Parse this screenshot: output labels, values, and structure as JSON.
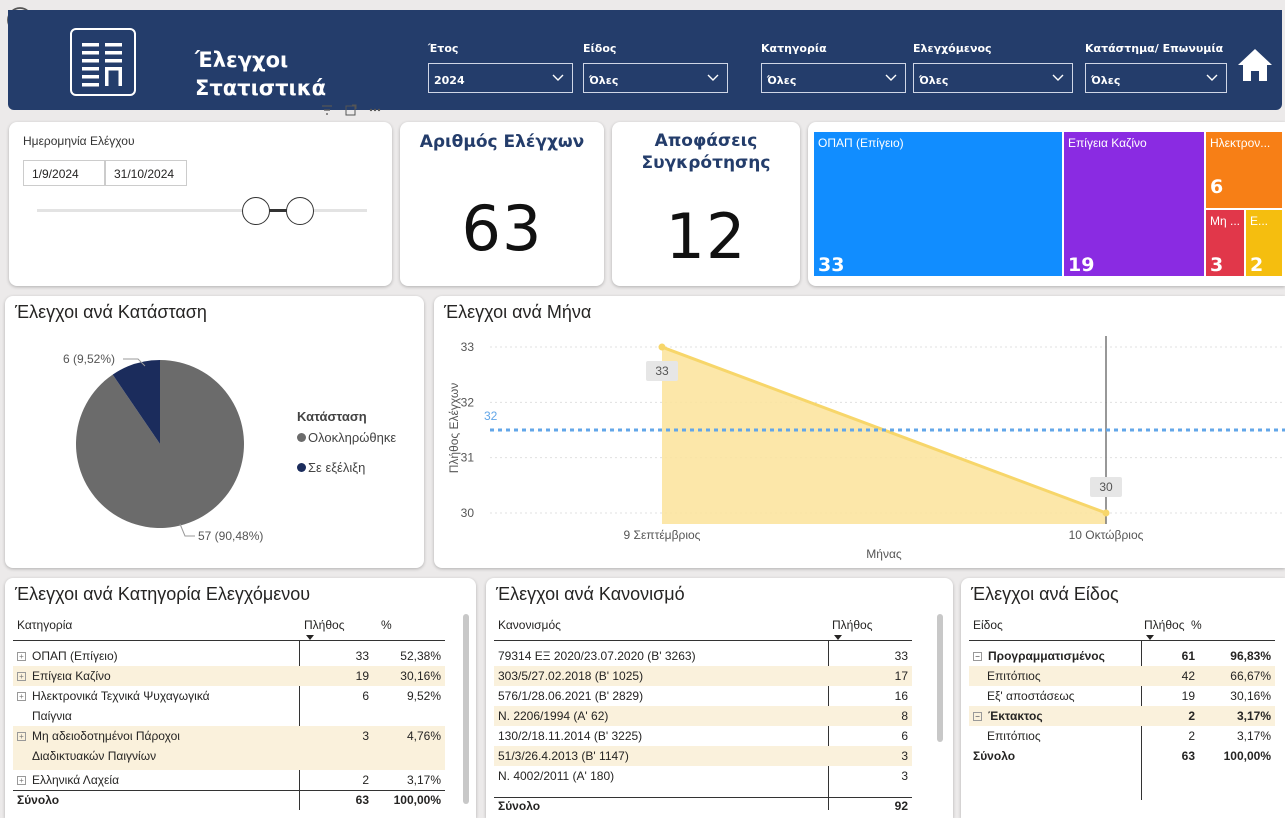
{
  "header": {
    "title_line1": "Έλεγχοι",
    "title_line2": "Στατιστικά",
    "logo_text_top": "ΞΞ",
    "logo_text_bottom": "ΞΠ",
    "filters": [
      {
        "label": "Έτος",
        "value": "2024"
      },
      {
        "label": "Είδος",
        "value": "Όλες"
      },
      {
        "label": "Κατηγορία",
        "value": "Όλες"
      },
      {
        "label": "Ελεγχόμενος",
        "value": "Όλες"
      },
      {
        "label": "Κατάστημα/ Επωνυμία",
        "value": "Όλες"
      }
    ]
  },
  "date_slicer": {
    "label": "Ημερομηνία Ελέγχου",
    "start": "1/9/2024",
    "end": "31/10/2024"
  },
  "kpis": {
    "checks_title": "Αριθμός Ελέγχων",
    "checks_value": "63",
    "decisions_title_line1": "Αποφάσεις",
    "decisions_title_line2": "Συγκρότησης",
    "decisions_value": "12"
  },
  "treemap": [
    {
      "label": "ΟΠΑΠ (Επίγειο)",
      "value": "33",
      "color": "#118dff"
    },
    {
      "label": "Επίγεια Καζίνο",
      "value": "19",
      "color": "#8a2be2"
    },
    {
      "label": "Ηλεκτρον...",
      "value": "6",
      "color": "#f77f16"
    },
    {
      "label": "Μη ...",
      "value": "3",
      "color": "#e1374a"
    },
    {
      "label": "Ε...",
      "value": "2",
      "color": "#f5be0f"
    }
  ],
  "pie_chart": {
    "title": "Έλεγχοι ανά Κατάσταση",
    "legend_title": "Κατάσταση",
    "label_small": "6 (9,52%)",
    "label_big": "57 (90,48%)",
    "colors": {
      "completed": "#6b6b6b",
      "in_progress": "#1b2c5c"
    },
    "chart_data": {
      "type": "pie",
      "categories": [
        "Ολοκληρώθηκε",
        "Σε εξέλιξη"
      ],
      "values": [
        57,
        6
      ]
    }
  },
  "line_chart": {
    "title": "Έλεγχοι ανά Μήνα",
    "ylabel": "Πλήθος Ελέγχων",
    "xlabel": "Μήνας",
    "avg_label": "32",
    "y_ticks": [
      "33",
      "32",
      "31",
      "30"
    ],
    "point_labels": [
      "33",
      "30"
    ],
    "colors": {
      "area": "#fbe39a",
      "line": "#f7d66a",
      "avg": "#62a6e8"
    },
    "chart_data": {
      "type": "area",
      "x": [
        "9 Σεπτέμβριος",
        "10 Οκτώβριος"
      ],
      "series": [
        {
          "values": [
            33,
            30
          ]
        }
      ],
      "average_line": 31.5,
      "ylim": [
        29.8,
        33.2
      ]
    }
  },
  "table_category": {
    "title": "Έλεγχοι ανά Κατηγορία Ελεγχόμενου",
    "headers": [
      "Κατηγορία",
      "Πλήθος",
      "%"
    ],
    "rows": [
      {
        "name": "ΟΠΑΠ (Επίγειο)",
        "count": "33",
        "pct": "52,38%"
      },
      {
        "name": "Επίγεια Καζίνο",
        "count": "19",
        "pct": "30,16%"
      },
      {
        "name": "Ηλεκτρονικά Τεχνικά Ψυχαγωγικά",
        "name2": "Παίγνια",
        "count": "6",
        "pct": "9,52%"
      },
      {
        "name": "Μη αδειοδοτημένοι Πάροχοι",
        "name2": "Διαδικτυακών Παιγνίων",
        "count": "3",
        "pct": "4,76%"
      },
      {
        "name": "Ελληνικά Λαχεία",
        "count": "2",
        "pct": "3,17%"
      }
    ],
    "total": {
      "name": "Σύνολο",
      "count": "63",
      "pct": "100,00%"
    }
  },
  "table_regulation": {
    "title": "Έλεγχοι ανά Κανονισμό",
    "headers": [
      "Κανονισμός",
      "Πλήθος"
    ],
    "rows": [
      {
        "name": "79314 ΕΞ 2020/23.07.2020 (Β' 3263)",
        "count": "33"
      },
      {
        "name": "303/5/27.02.2018 (Β' 1025)",
        "count": "17"
      },
      {
        "name": "576/1/28.06.2021 (Β' 2829)",
        "count": "16"
      },
      {
        "name": "Ν. 2206/1994 (Α' 62)",
        "count": "8"
      },
      {
        "name": "130/2/18.11.2014 (Β' 3225)",
        "count": "6"
      },
      {
        "name": "51/3/26.4.2013 (Β' 1147)",
        "count": "3"
      },
      {
        "name": "Ν. 4002/2011 (Α' 180)",
        "count": "3"
      }
    ],
    "total": {
      "name": "Σύνολο",
      "count": "92"
    }
  },
  "table_type": {
    "title": "Έλεγχοι ανά Είδος",
    "headers": [
      "Είδος",
      "Πλήθος",
      "%"
    ],
    "rows": [
      {
        "name": "Προγραμματισμένος",
        "count": "61",
        "pct": "96,83%"
      },
      {
        "name": "Επιτόπιος",
        "count": "42",
        "pct": "66,67%"
      },
      {
        "name": "Εξ' αποστάσεως",
        "count": "19",
        "pct": "30,16%"
      },
      {
        "name": "Έκτακτος",
        "count": "2",
        "pct": "3,17%"
      },
      {
        "name": "Επιτόπιος",
        "count": "2",
        "pct": "3,17%"
      }
    ],
    "total": {
      "name": "Σύνολο",
      "count": "63",
      "pct": "100,00%"
    }
  }
}
